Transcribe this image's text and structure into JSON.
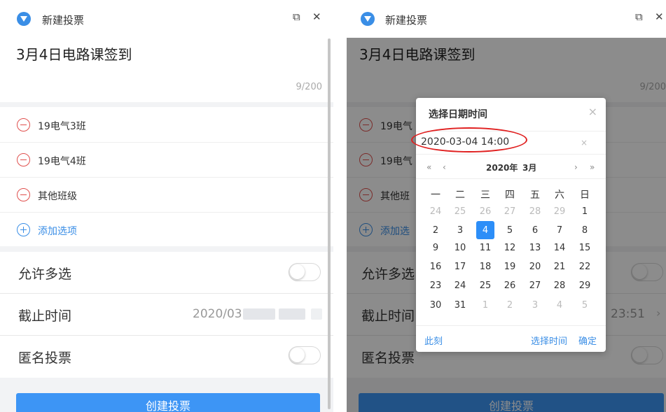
{
  "colors": {
    "accent": "#3a8ee6",
    "danger": "#e0504e",
    "button": "#3d95f5",
    "selected_day": "#2c8ef8",
    "highlight_ring": "#e02020"
  },
  "left": {
    "app_title": "新建投票",
    "edit_icon": "⧉",
    "close_icon": "✕",
    "vote_title": "3月4日电路课签到",
    "char_count": "9/200",
    "options": [
      "19电气3班",
      "19电气4班",
      "其他班级"
    ],
    "add_option": "添加选项",
    "settings": {
      "multi": "允许多选",
      "deadline": "截止时间",
      "deadline_value": "2020/03",
      "anonymous": "匿名投票"
    },
    "create_button": "创建投票"
  },
  "right": {
    "app_title": "新建投票",
    "edit_icon": "⧉",
    "close_icon": "✕",
    "vote_title": "3月4日电路课签到",
    "char_count": "9/200",
    "options": [
      "19电气",
      "19电气",
      "其他班"
    ],
    "add_option": "添加选",
    "settings": {
      "multi": "允许多选",
      "deadline": "截止时间",
      "deadline_value": "23:51",
      "anonymous": "匿名投票"
    },
    "create_button": "创建投票"
  },
  "picker": {
    "title": "选择日期时间",
    "close": "×",
    "input_value": "2020-03-04 14:00",
    "clear": "×",
    "nav_prev_year": "«",
    "nav_prev_month": "‹",
    "year": "2020年",
    "month": "3月",
    "nav_next_month": "›",
    "nav_next_year": "»",
    "weekdays": [
      "一",
      "二",
      "三",
      "四",
      "五",
      "六",
      "日"
    ],
    "days": [
      [
        "24",
        "25",
        "26",
        "27",
        "28",
        "29",
        "1"
      ],
      [
        "2",
        "3",
        "4",
        "5",
        "6",
        "7",
        "8"
      ],
      [
        "9",
        "10",
        "11",
        "12",
        "13",
        "14",
        "15"
      ],
      [
        "16",
        "17",
        "18",
        "19",
        "20",
        "21",
        "22"
      ],
      [
        "23",
        "24",
        "25",
        "26",
        "27",
        "28",
        "29"
      ],
      [
        "30",
        "31",
        "1",
        "2",
        "3",
        "4",
        "5"
      ]
    ],
    "now": "此刻",
    "select_time": "选择时间",
    "confirm": "确定"
  }
}
